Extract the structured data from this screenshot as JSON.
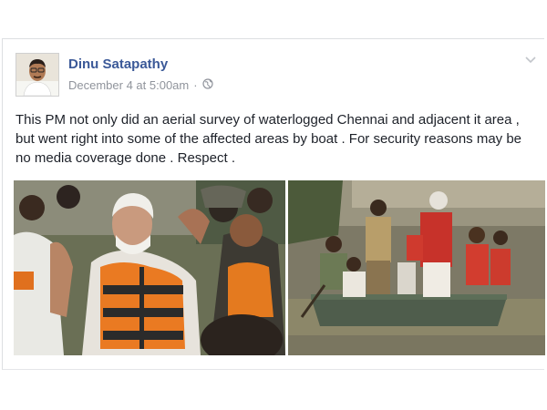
{
  "post": {
    "author": "Dinu Satapathy",
    "timestamp": "December 4 at 5:00am",
    "separator": "·",
    "privacy_icon": "globe-icon",
    "menu_icon": "chevron-down-icon",
    "text": "This PM not only did an aerial survey of waterlogged Chennai and adjacent it area , but went right into some of the affected areas by boat . For security reasons may be no media coverage done . Respect ."
  },
  "colors": {
    "author_link": "#3b5998",
    "meta_gray": "#90949c",
    "body_text": "#1d2129",
    "border": "#dddfe2"
  }
}
